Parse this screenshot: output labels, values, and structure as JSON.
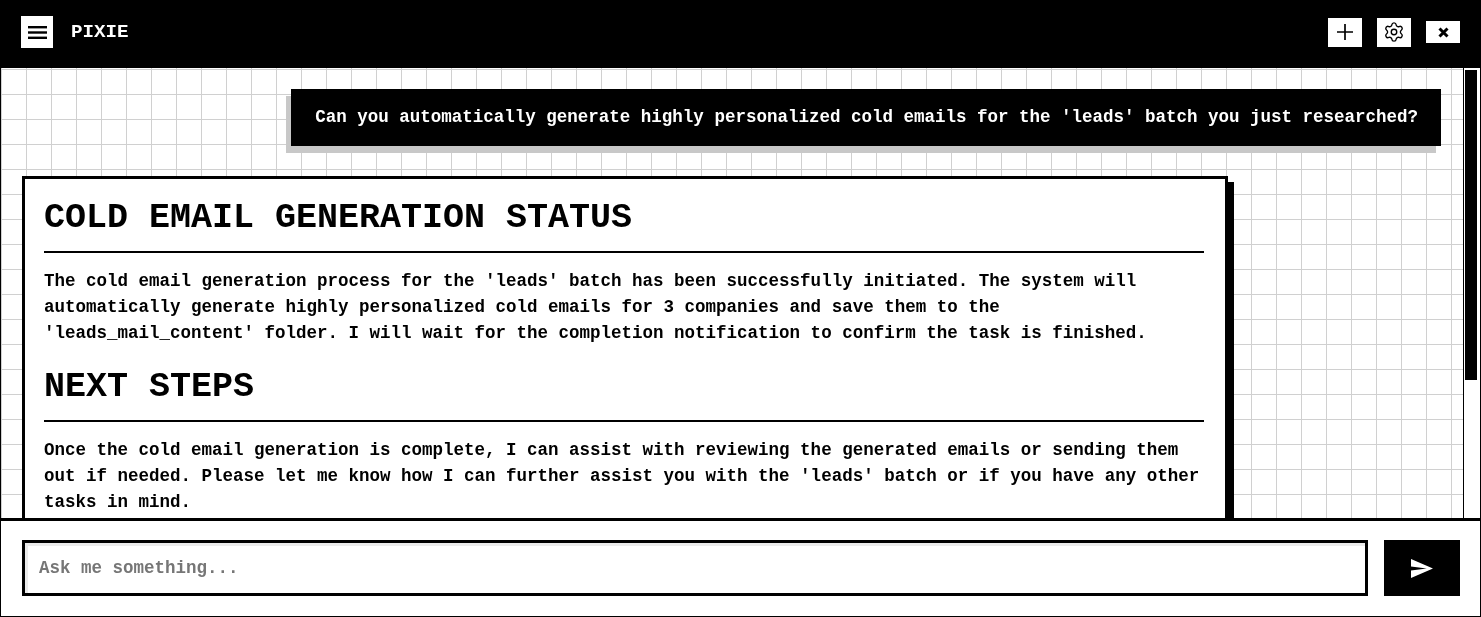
{
  "app": {
    "title": "PIXIE"
  },
  "messages": [
    {
      "kind": "user",
      "text": "Can you automatically generate highly personalized cold emails for the 'leads' batch you just researched?"
    },
    {
      "kind": "assistant",
      "sections": [
        {
          "heading": "COLD EMAIL GENERATION STATUS",
          "body": "The cold email generation process for the 'leads' batch has been successfully initiated. The system will automatically generate highly personalized cold emails for 3 companies and save them to the 'leads_mail_content' folder. I will wait for the completion notification to confirm the task is finished."
        },
        {
          "heading": "NEXT STEPS",
          "body": "Once the cold email generation is complete, I can assist with reviewing the generated emails or sending them out if needed. Please let me know how I can further assist you with the 'leads' batch or if you have any other tasks in mind."
        }
      ]
    }
  ],
  "composer": {
    "placeholder": "Ask me something..."
  }
}
